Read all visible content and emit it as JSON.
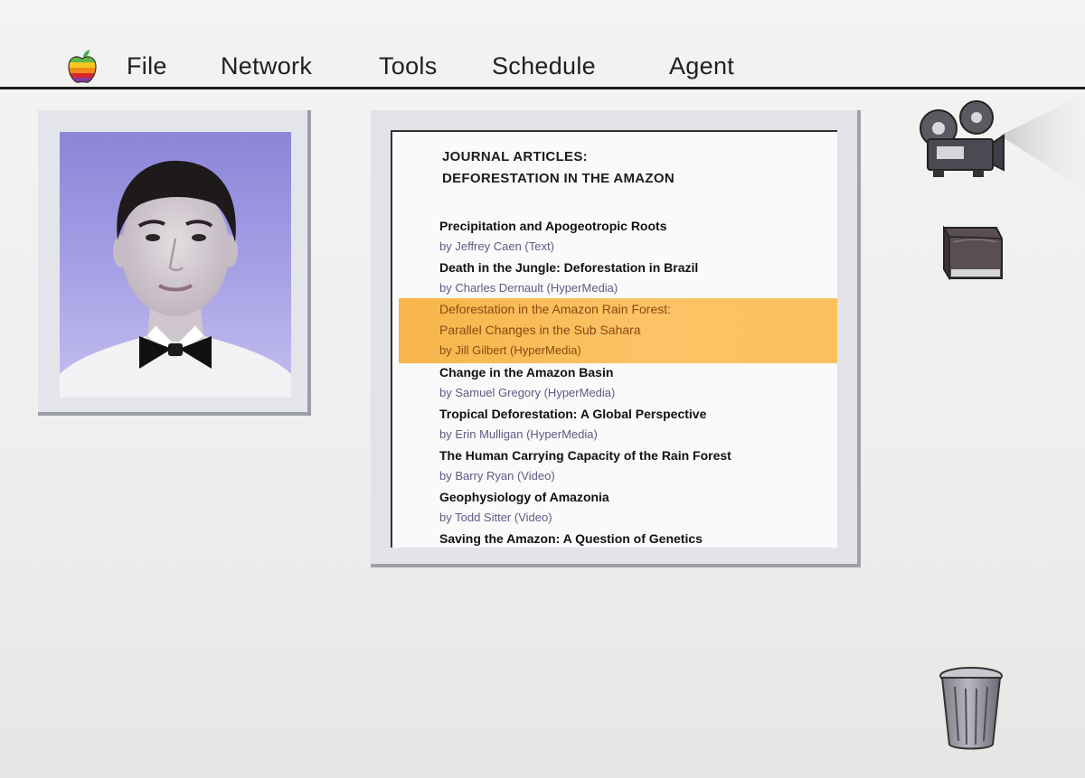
{
  "menu": {
    "items": [
      "File",
      "Network",
      "Tools",
      "Schedule",
      "Agent"
    ]
  },
  "document": {
    "title_line1": "JOURNAL ARTICLES:",
    "title_line2": "DEFORESTATION IN THE AMAZON",
    "articles": [
      {
        "title": "Precipitation and Apogeotropic Roots",
        "byline": "by Jeffrey Caen  (Text)"
      },
      {
        "title": "Death in the Jungle: Deforestation in Brazil",
        "byline": "by Charles Dernault  (HyperMedia)"
      },
      {
        "title": "Deforestation in the Amazon Rain Forest:",
        "title2": "Parallel Changes in the Sub Sahara",
        "byline": "by Jill Gilbert  (HyperMedia)",
        "selected": true
      },
      {
        "title": "Change in the Amazon Basin",
        "byline": "by Samuel Gregory  (HyperMedia)"
      },
      {
        "title": "Tropical Deforestation: A Global Perspective",
        "byline": "by Erin Mulligan  (HyperMedia)"
      },
      {
        "title": "The Human Carrying Capacity of the Rain Forest",
        "byline": "by Barry Ryan  (Video)"
      },
      {
        "title": "Geophysiology of Amazonia",
        "byline": "by Todd Sitter  (Video)"
      },
      {
        "title": "Saving the Amazon: A Question of Genetics",
        "byline": ""
      }
    ]
  },
  "colors": {
    "highlight": "#fcc266",
    "photo_background": "#9f98e2"
  },
  "icons": [
    "apple-logo-icon",
    "video-camera-icon",
    "book-icon",
    "trash-can-icon"
  ]
}
